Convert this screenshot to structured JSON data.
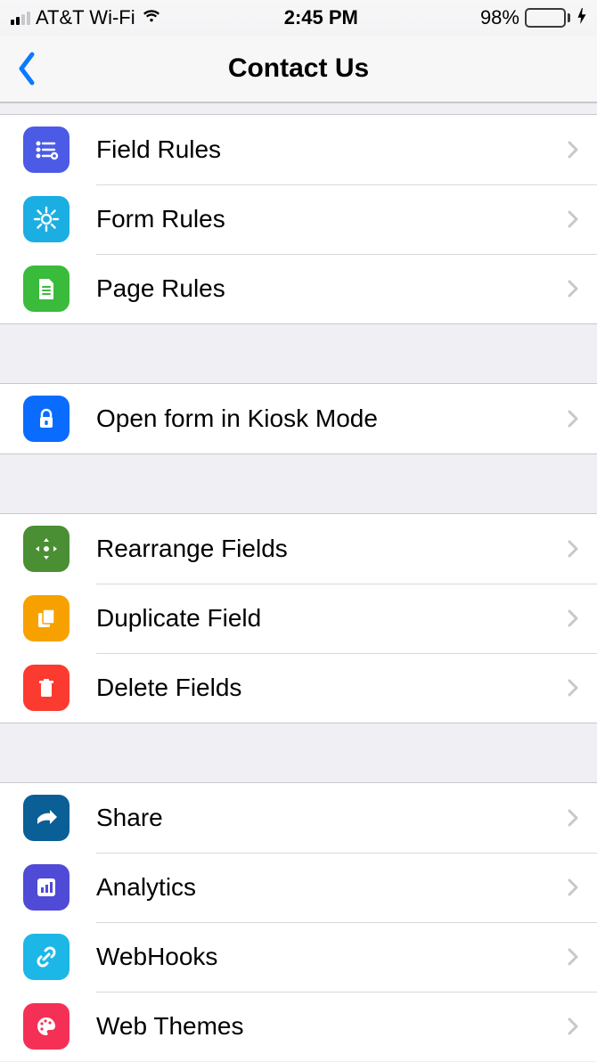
{
  "status": {
    "carrier": "AT&T Wi-Fi",
    "time": "2:45 PM",
    "battery_pct": "98%"
  },
  "nav": {
    "title": "Contact Us"
  },
  "sections": {
    "rules": {
      "items": [
        {
          "label": "Field Rules"
        },
        {
          "label": "Form Rules"
        },
        {
          "label": "Page Rules"
        }
      ]
    },
    "kiosk": {
      "items": [
        {
          "label": "Open form in Kiosk Mode"
        }
      ]
    },
    "fields": {
      "items": [
        {
          "label": "Rearrange Fields"
        },
        {
          "label": "Duplicate Field"
        },
        {
          "label": "Delete Fields"
        }
      ]
    },
    "more": {
      "items": [
        {
          "label": "Share"
        },
        {
          "label": "Analytics"
        },
        {
          "label": "WebHooks"
        },
        {
          "label": "Web Themes"
        }
      ]
    }
  }
}
